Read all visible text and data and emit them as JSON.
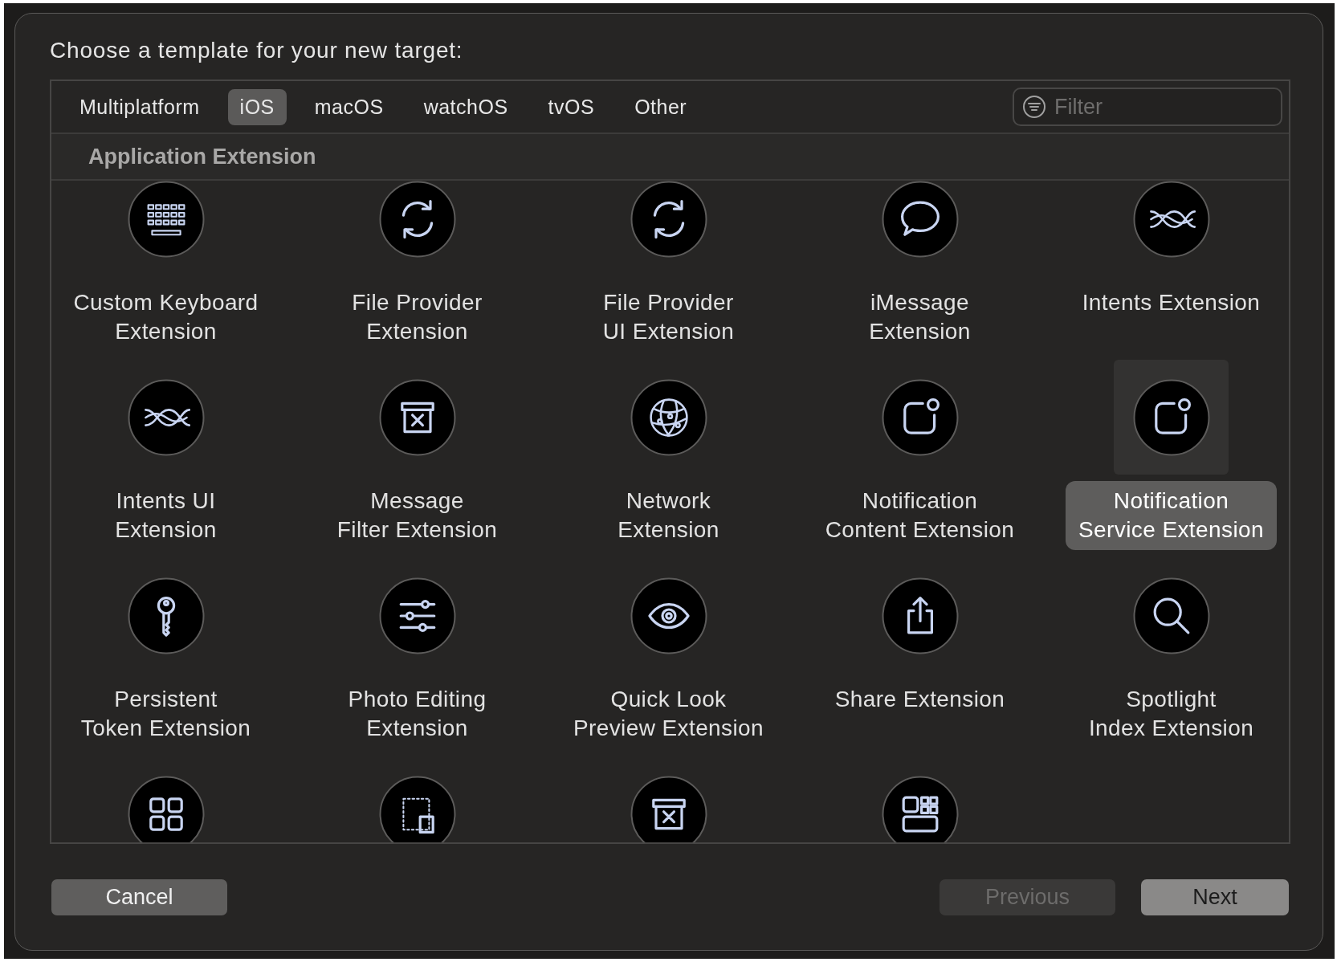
{
  "dialog": {
    "title": "Choose a template for your new target:"
  },
  "tabs": [
    {
      "label": "Multiplatform",
      "selected": false
    },
    {
      "label": "iOS",
      "selected": true
    },
    {
      "label": "macOS",
      "selected": false
    },
    {
      "label": "watchOS",
      "selected": false
    },
    {
      "label": "tvOS",
      "selected": false
    },
    {
      "label": "Other",
      "selected": false
    }
  ],
  "filter": {
    "placeholder": "Filter"
  },
  "section": {
    "title": "Application Extension"
  },
  "templates": [
    {
      "kind": "keyboard",
      "label": "Custom Keyboard\nExtension",
      "selected": false
    },
    {
      "kind": "sync",
      "label": "File Provider\nExtension",
      "selected": false
    },
    {
      "kind": "sync",
      "label": "File Provider\nUI Extension",
      "selected": false
    },
    {
      "kind": "bubble",
      "label": "iMessage\nExtension",
      "selected": false
    },
    {
      "kind": "waves",
      "label": "Intents Extension",
      "selected": false
    },
    {
      "kind": "waves",
      "label": "Intents UI\nExtension",
      "selected": false
    },
    {
      "kind": "archive",
      "label": "Message\nFilter Extension",
      "selected": false
    },
    {
      "kind": "globe",
      "label": "Network\nExtension",
      "selected": false
    },
    {
      "kind": "notification",
      "label": "Notification\nContent Extension",
      "selected": false
    },
    {
      "kind": "notification",
      "label": "Notification\nService Extension",
      "selected": true
    },
    {
      "kind": "key",
      "label": "Persistent\nToken Extension",
      "selected": false
    },
    {
      "kind": "sliders",
      "label": "Photo Editing\nExtension",
      "selected": false
    },
    {
      "kind": "eye",
      "label": "Quick Look\nPreview Extension",
      "selected": false
    },
    {
      "kind": "share",
      "label": "Share Extension",
      "selected": false
    },
    {
      "kind": "search",
      "label": "Spotlight\nIndex Extension",
      "selected": false
    },
    {
      "kind": "grid",
      "selected": false
    },
    {
      "kind": "corner",
      "selected": false
    },
    {
      "kind": "archive",
      "selected": false
    },
    {
      "kind": "widgets",
      "selected": false
    }
  ],
  "buttons": [
    {
      "label": "Cancel",
      "kind": "normal",
      "disabled": false
    },
    {
      "label": "Previous",
      "kind": "normal",
      "disabled": true
    },
    {
      "label": "Next",
      "kind": "default",
      "disabled": false
    }
  ]
}
